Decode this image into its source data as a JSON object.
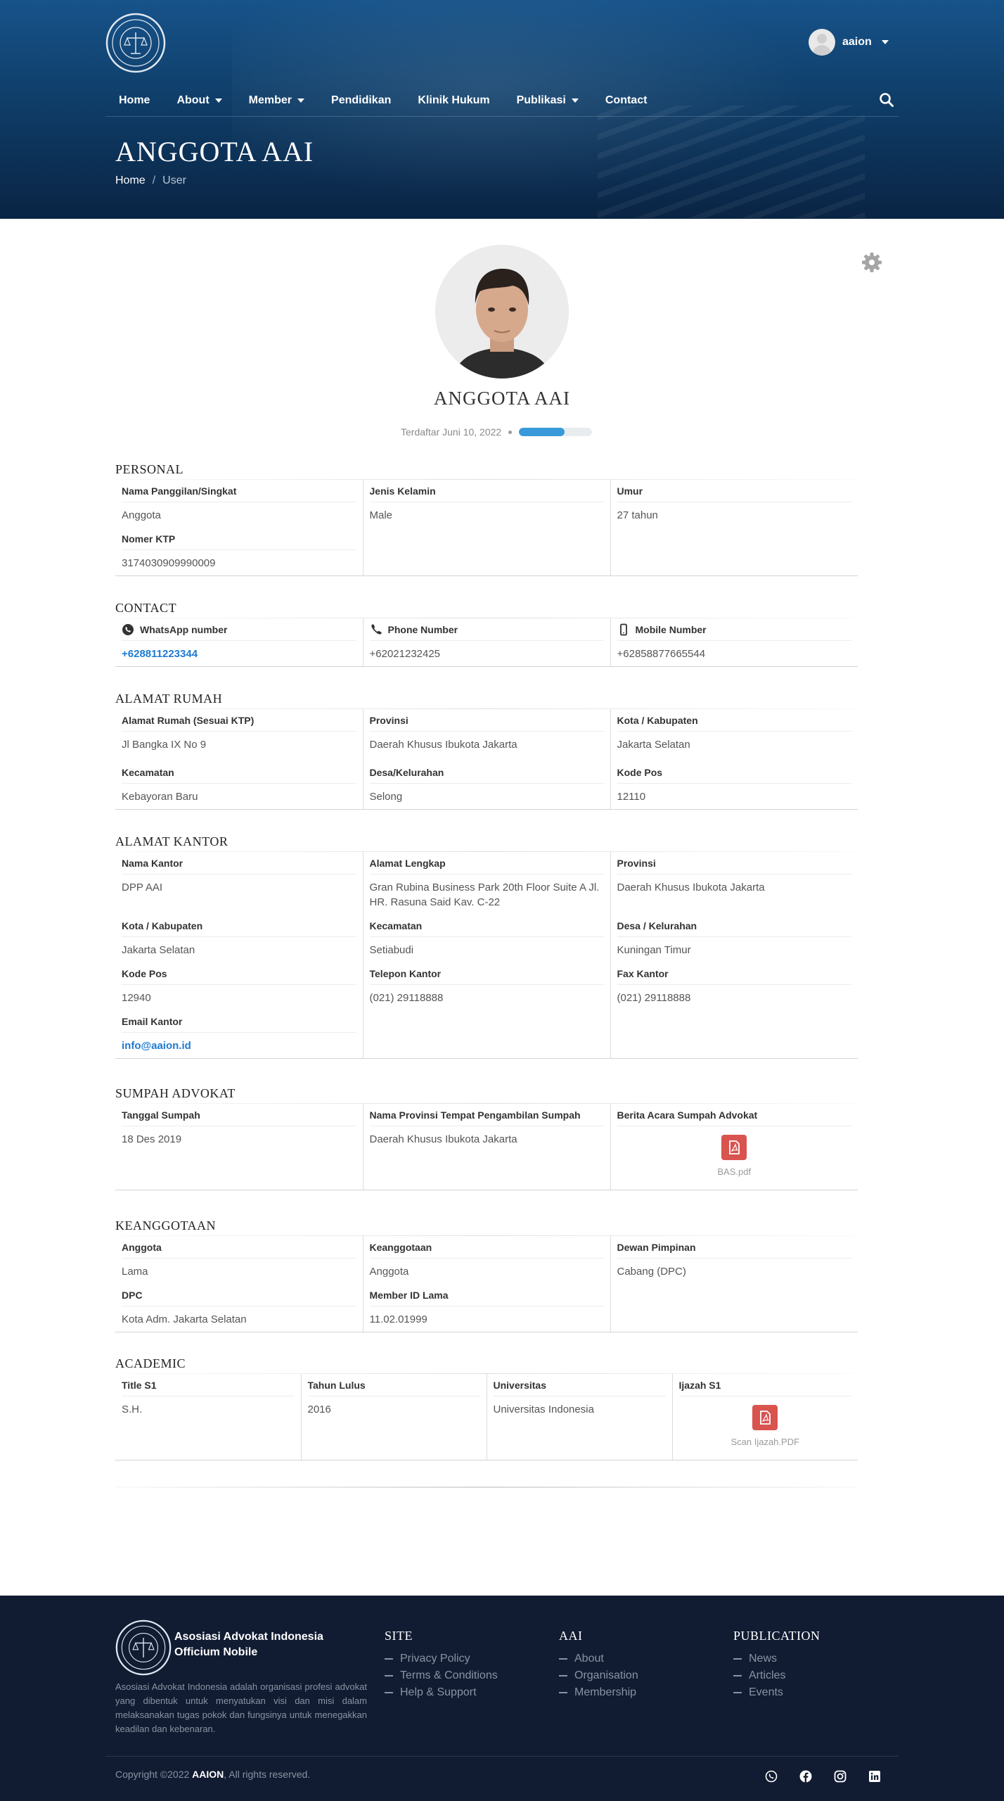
{
  "header": {
    "username": "aaion",
    "nav": [
      {
        "label": "Home",
        "dropdown": false
      },
      {
        "label": "About",
        "dropdown": true
      },
      {
        "label": "Member",
        "dropdown": true
      },
      {
        "label": "Pendidikan",
        "dropdown": false
      },
      {
        "label": "Klinik Hukum",
        "dropdown": false
      },
      {
        "label": "Publikasi",
        "dropdown": true
      },
      {
        "label": "Contact",
        "dropdown": false
      }
    ],
    "page_title": "ANGGOTA AAI",
    "breadcrumb": {
      "home": "Home",
      "separator": "/",
      "current": "User"
    }
  },
  "profile": {
    "name": "ANGGOTA AAI",
    "registered": "Terdaftar Juni 10, 2022",
    "completion_percent": 62
  },
  "personal": {
    "title": "PERSONAL",
    "nickname_label": "Nama Panggilan/Singkat",
    "nickname": "Anggota",
    "gender_label": "Jenis Kelamin",
    "gender": "Male",
    "age_label": "Umur",
    "age": "27 tahun",
    "ktp_label": "Nomer KTP",
    "ktp": "3174030909990009"
  },
  "contact": {
    "title": "CONTACT",
    "whatsapp_label": "WhatsApp number",
    "whatsapp": "+628811223344",
    "phone_label": "Phone Number",
    "phone": "+62021232425",
    "mobile_label": "Mobile Number",
    "mobile": "+62858877665544"
  },
  "home_address": {
    "title": "ALAMAT RUMAH",
    "address_label": "Alamat Rumah (Sesuai KTP)",
    "address": "Jl Bangka IX No 9",
    "province_label": "Provinsi",
    "province": "Daerah Khusus Ibukota Jakarta",
    "city_label": "Kota / Kabupaten",
    "city": "Jakarta Selatan",
    "district_label": "Kecamatan",
    "district": "Kebayoran Baru",
    "village_label": "Desa/Kelurahan",
    "village": "Selong",
    "postal_label": "Kode Pos",
    "postal": "12110"
  },
  "office_address": {
    "title": "ALAMAT KANTOR",
    "office_label": "Nama Kantor",
    "office": "DPP AAI",
    "address_label": "Alamat Lengkap",
    "address": "Gran Rubina Business Park 20th Floor Suite A Jl. HR. Rasuna Said Kav. C-22",
    "province_label": "Provinsi",
    "province": "Daerah Khusus Ibukota Jakarta",
    "city_label": "Kota / Kabupaten",
    "city": "Jakarta Selatan",
    "district_label": "Kecamatan",
    "district": "Setiabudi",
    "village_label": "Desa / Kelurahan",
    "village": "Kuningan Timur",
    "postal_label": "Kode Pos",
    "postal": "12940",
    "phone_label": "Telepon Kantor",
    "phone": "(021) 29118888",
    "fax_label": "Fax Kantor",
    "fax": "(021) 29118888",
    "email_label": "Email Kantor",
    "email": "info@aaion.id"
  },
  "oath": {
    "title": "SUMPAH ADVOKAT",
    "date_label": "Tanggal Sumpah",
    "date": "18 Des 2019",
    "province_label": "Nama Provinsi Tempat Pengambilan Sumpah",
    "province": "Daerah Khusus Ibukota Jakarta",
    "doc_label": "Berita Acara Sumpah Advokat",
    "doc_file": "BAS.pdf"
  },
  "membership": {
    "title": "KEANGGOTAAN",
    "member_label": "Anggota",
    "member": "Lama",
    "membership_label": "Keanggotaan",
    "membership": "Anggota",
    "board_label": "Dewan Pimpinan",
    "board": "Cabang (DPC)",
    "dpc_label": "DPC",
    "dpc": "Kota Adm. Jakarta Selatan",
    "old_id_label": "Member ID Lama",
    "old_id": "11.02.01999"
  },
  "academic": {
    "title": "ACADEMIC",
    "degree_label": "Title S1",
    "degree": "S.H.",
    "year_label": "Tahun Lulus",
    "year": "2016",
    "university_label": "Universitas",
    "university": "Universitas Indonesia",
    "diploma_label": "Ijazah S1",
    "diploma_file": "Scan Ijazah.PDF"
  },
  "footer": {
    "org_line1": "Asosiasi Advokat Indonesia",
    "org_line2": "Officium Nobile",
    "description": "Asosiasi Advokat Indonesia adalah organisasi profesi advokat yang dibentuk untuk menyatukan visi dan misi dalam melaksanakan tugas pokok dan fungsinya untuk menegakkan keadilan dan kebenaran.",
    "columns": [
      {
        "title": "SITE",
        "links": [
          "Privacy Policy",
          "Terms & Conditions",
          "Help & Support"
        ]
      },
      {
        "title": "AAI",
        "links": [
          "About",
          "Organisation",
          "Membership"
        ]
      },
      {
        "title": "PUBLICATION",
        "links": [
          "News",
          "Articles",
          "Events"
        ]
      }
    ],
    "copyright_prefix": "Copyright ©2022 ",
    "copyright_brand": "AAION",
    "copyright_suffix": ", All rights reserved.",
    "socials": [
      "whatsapp-icon",
      "facebook-icon",
      "instagram-icon",
      "linkedin-icon"
    ]
  },
  "colors": {
    "header": "#17538a",
    "footer": "#111c32",
    "link": "#1f7ad1",
    "progress": "#3a9ad9",
    "pdf": "#d9534f"
  }
}
